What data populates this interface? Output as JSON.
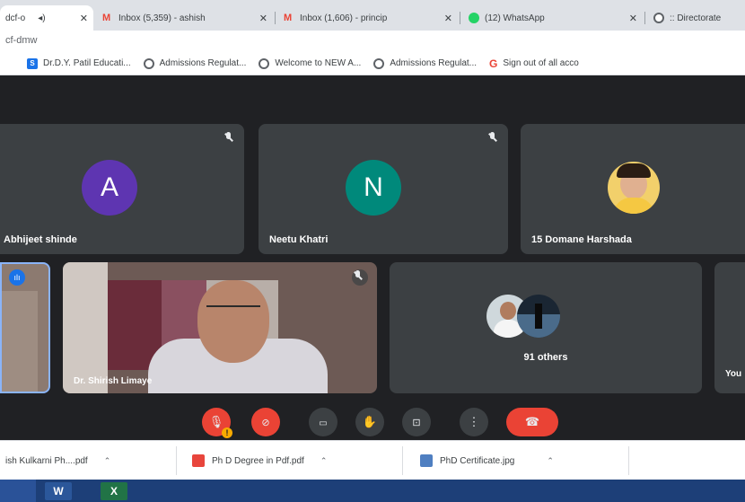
{
  "browser": {
    "tabs": [
      {
        "label": "dcf-o",
        "active": true
      },
      {
        "label": "Inbox (5,359) - ashish",
        "icon": "gmail-icon"
      },
      {
        "label": "Inbox (1,606) - princip",
        "icon": "gmail-icon"
      },
      {
        "label": "(12) WhatsApp",
        "icon": "whatsapp-icon"
      },
      {
        "label": ":: Directorate",
        "icon": "globe-icon"
      }
    ],
    "address": "cf-dmw",
    "bookmarks": [
      {
        "label": "Dr.D.Y. Patil Educati...",
        "icon": "dy-icon"
      },
      {
        "label": "Admissions Regulat...",
        "icon": "globe-icon"
      },
      {
        "label": "Welcome to NEW A...",
        "icon": "globe-icon"
      },
      {
        "label": "Admissions Regulat...",
        "icon": "globe-icon"
      },
      {
        "label": "Sign out of all acco",
        "icon": "google-icon"
      }
    ]
  },
  "meet": {
    "participants": [
      {
        "name": "Abhijeet shinde",
        "initial": "A",
        "color": "#5e35b1"
      },
      {
        "name": "Neetu Khatri",
        "initial": "N",
        "color": "#00897b"
      },
      {
        "name": "15 Domane Harshada"
      }
    ],
    "video_participant": {
      "name": "Dr. Shirish Limaye"
    },
    "others": {
      "label": "91 others"
    },
    "edge_label": "You",
    "controls": {
      "alert": "!"
    }
  },
  "downloads": [
    {
      "label": "ish Kulkarni Ph....pdf",
      "icon": "pdf-icon"
    },
    {
      "label": "Ph D Degree in Pdf.pdf",
      "icon": "pdf-icon"
    },
    {
      "label": "PhD Certificate.jpg",
      "icon": "image-icon"
    }
  ],
  "taskbar": {
    "apps": [
      {
        "label": "W",
        "color": "#2b579a"
      },
      {
        "label": "X",
        "color": "#217346"
      }
    ]
  }
}
